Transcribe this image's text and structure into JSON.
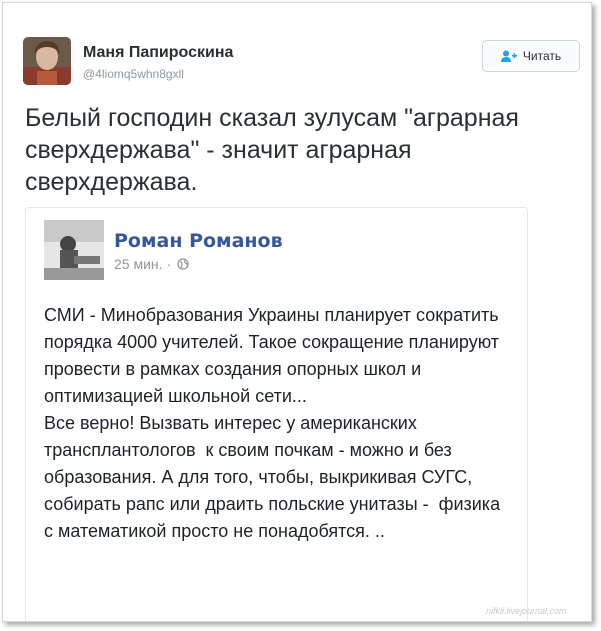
{
  "tweet": {
    "author_name": "Маня Папироскина",
    "handle": "@4liomq5whn8gxll",
    "follow_label": "Читать",
    "text": "Белый господин сказал зулусам \"аграрная сверхдержава\" - значит аграрная сверхдержава."
  },
  "embedded_post": {
    "author_name": "Роман Романов",
    "time": "25 мин.",
    "separator": "·",
    "privacy_icon": "globe-icon",
    "body": "СМИ - Минобразования Украины планирует сократить порядка 4000 учителей. Такое сокращение планируют провести в рамках создания опорных школ и оптимизацией школьной сети...\nВсе верно! Вызвать интерес у американских трансплантологов  к своим почкам - можно и без образования. А для того, чтобы, выкрикивая СУГС, собирать рапс или драить польские унитазы -  физика с математикой просто не понадобятся. .."
  },
  "watermark": "nifkii.livejournal.com",
  "colors": {
    "fb_name": "#365899",
    "tweet_text": "#292f33",
    "handle": "#8899a6",
    "follow_icon": "#1da1f2"
  }
}
